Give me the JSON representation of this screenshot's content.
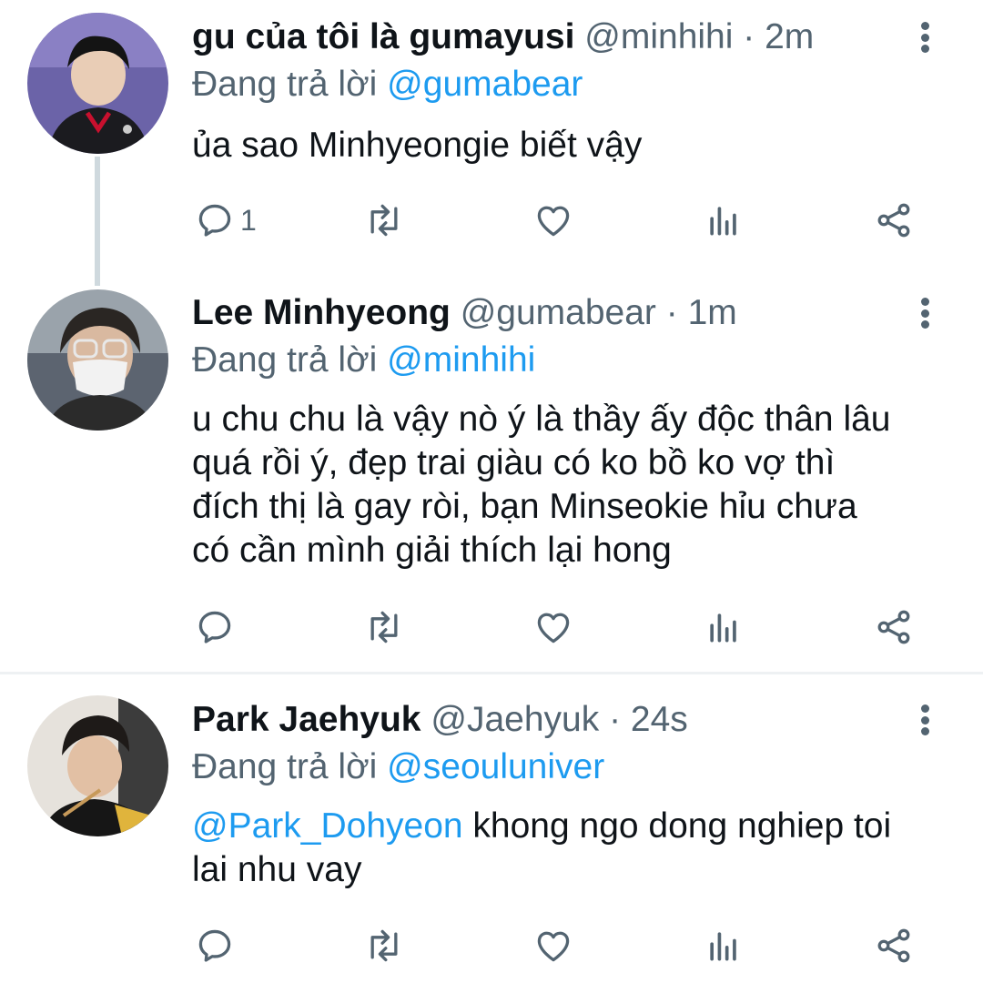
{
  "tweets": [
    {
      "display_name": "gu của tôi là gumayusi",
      "handle": "@minhihi",
      "time": "· 2m",
      "reply_prefix": "Đang trả lời",
      "reply_to": "@gumabear",
      "text_lines": [
        "ủa sao Minhyeongie biết vậy"
      ],
      "reply_count": "1",
      "avatar_icon": "avatar-photo"
    },
    {
      "display_name": "Lee Minhyeong",
      "handle": "@gumabear",
      "time": "· 1m",
      "reply_prefix": "Đang trả lời",
      "reply_to": "@minhihi",
      "text_lines": [
        "u chu chu là vậy nò ý là thầy ấy độc thân lâu",
        "quá rồi ý, đẹp trai giàu có ko bồ ko vợ thì",
        "đích thị là gay ròi, bạn Minseokie hỉu chưa",
        "có cần mình giải thích lại hong"
      ],
      "reply_count": "",
      "avatar_icon": "avatar-photo"
    },
    {
      "display_name": "Park Jaehyuk",
      "handle": "@Jaehyuk",
      "time": "· 24s",
      "reply_prefix": "Đang trả lời",
      "reply_to": "@seouluniver",
      "mention": "@Park_Dohyeon",
      "text_first": " khong ngo dong nghiep toi",
      "text_second": "lai nhu vay",
      "reply_count": "",
      "avatar_icon": "avatar-photo"
    }
  ],
  "icons": [
    "reply-icon",
    "retweet-icon",
    "like-icon",
    "analytics-icon",
    "share-icon",
    "more-options-icon"
  ],
  "colors": {
    "link": "#1d9bf0",
    "text": "#0f1419",
    "muted": "#536471",
    "thread_line": "#cfd9de"
  }
}
